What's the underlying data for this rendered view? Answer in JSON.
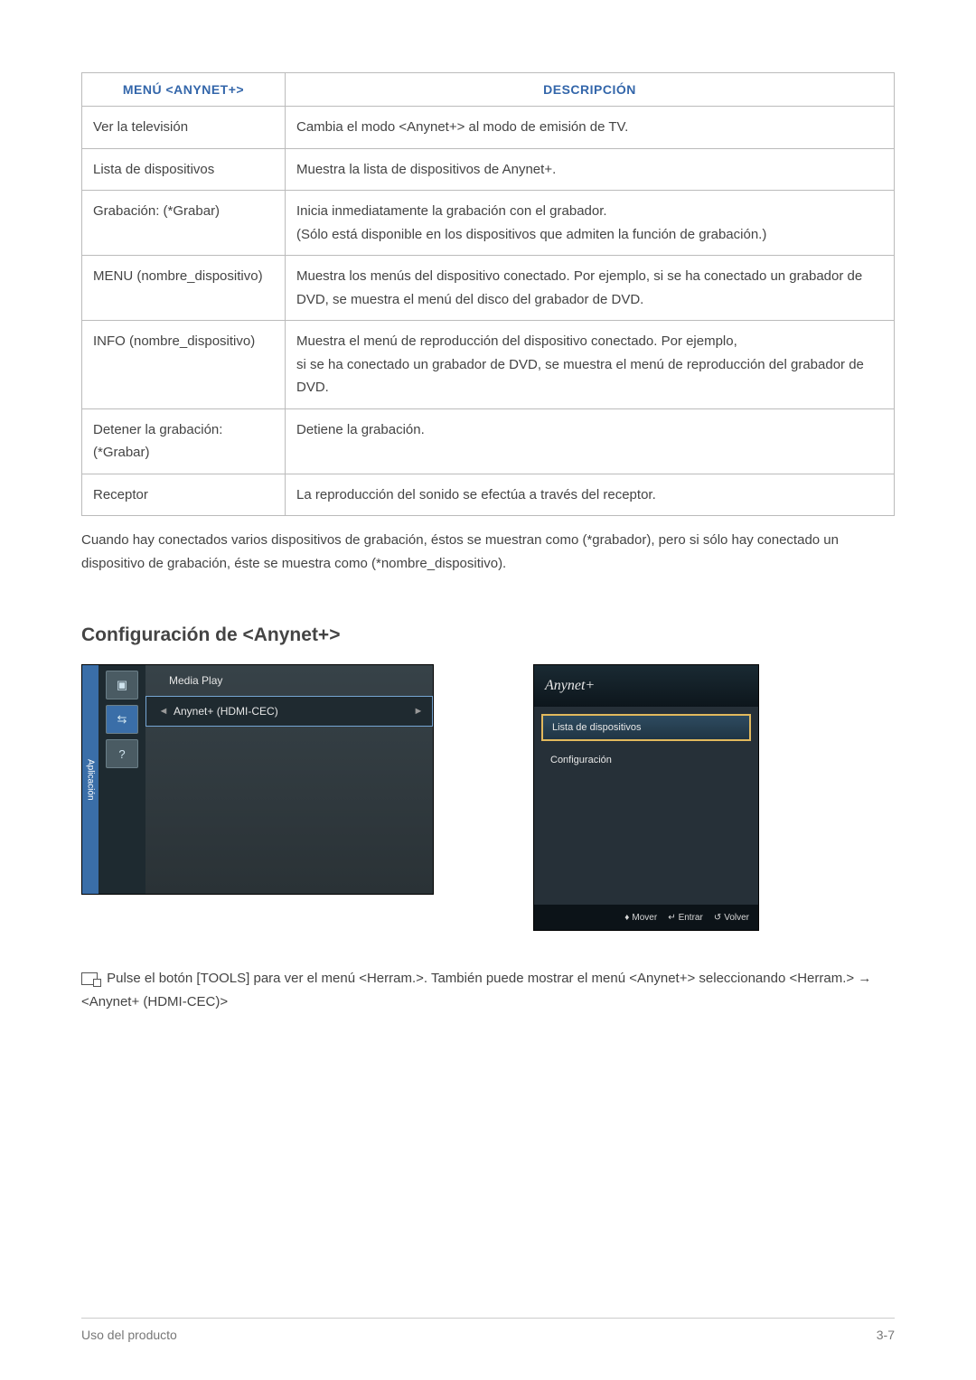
{
  "table": {
    "header_menu": "MENÚ <ANYNET+>",
    "header_desc": "DESCRIPCIÓN",
    "rows": [
      {
        "menu": "Ver la televisión",
        "desc": "Cambia el modo <Anynet+> al modo de emisión de TV."
      },
      {
        "menu": "Lista de dispositivos",
        "desc": "Muestra la lista de dispositivos de Anynet+."
      },
      {
        "menu": "Grabación: (*Grabar)",
        "desc": "Inicia inmediatamente la grabación con el grabador.\n(Sólo está disponible en los dispositivos que admiten la función de grabación.)"
      },
      {
        "menu": "MENU (nombre_dispositivo)",
        "desc": "Muestra los menús del dispositivo conectado. Por ejemplo, si se ha conectado un grabador de DVD, se muestra el menú del disco del grabador de DVD."
      },
      {
        "menu": "INFO (nombre_dispositivo)",
        "desc": "Muestra el menú de reproducción del dispositivo conectado. Por ejemplo,\nsi se ha conectado un grabador de DVD, se muestra el menú de reproducción del grabador de DVD."
      },
      {
        "menu": "Detener la grabación: (*Grabar)",
        "desc": "Detiene la grabación."
      },
      {
        "menu": "Receptor",
        "desc": "La reproducción del sonido se efectúa a través del receptor."
      }
    ],
    "note_after": "Cuando hay conectados varios dispositivos de grabación, éstos se muestran como (*grabador), pero si sólo hay conectado un dispositivo de grabación, éste se muestra como (*nombre_dispositivo)."
  },
  "section_title": "Configuración de <Anynet+>",
  "left_shot": {
    "sidebar_label": "Aplicación",
    "row1": "Media Play",
    "row2": "Anynet+ (HDMI-CEC)"
  },
  "right_shot": {
    "title": "Anynet+",
    "item1": "Lista de dispositivos",
    "item2": "Configuración",
    "footer_move": "Mover",
    "footer_enter": "Entrar",
    "footer_return": "Volver"
  },
  "tip_text": "Pulse el botón [TOOLS] para ver el menú <Herram.>. También puede mostrar el menú <Anynet+> seleccionando <Herram.> → <Anynet+ (HDMI-CEC)>",
  "footer": {
    "left": "Uso del producto",
    "right": "3-7"
  }
}
